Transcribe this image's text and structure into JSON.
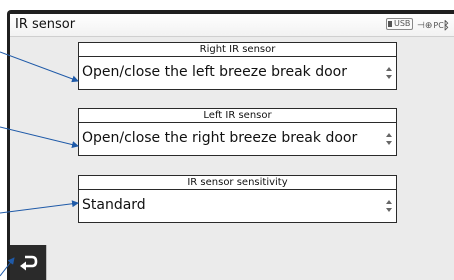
{
  "window": {
    "title": "IR sensor"
  },
  "status_bar": {
    "usb_label": "USB",
    "pc_label": "PC",
    "bluetooth_icon": "bluetooth-icon"
  },
  "settings": [
    {
      "label": "Right IR sensor",
      "value": "Open/close the left breeze break door"
    },
    {
      "label": "Left IR sensor",
      "value": "Open/close the right breeze break door"
    },
    {
      "label": "IR sensor sensitivity",
      "value": "Standard"
    }
  ],
  "footer": {
    "back_icon": "back-arrow-icon"
  },
  "colors": {
    "frame": "#1f1f1f",
    "screen_background": "#ebebeb",
    "callout_arrow": "#1f5aa8",
    "back_button": "#2a2a2a"
  }
}
